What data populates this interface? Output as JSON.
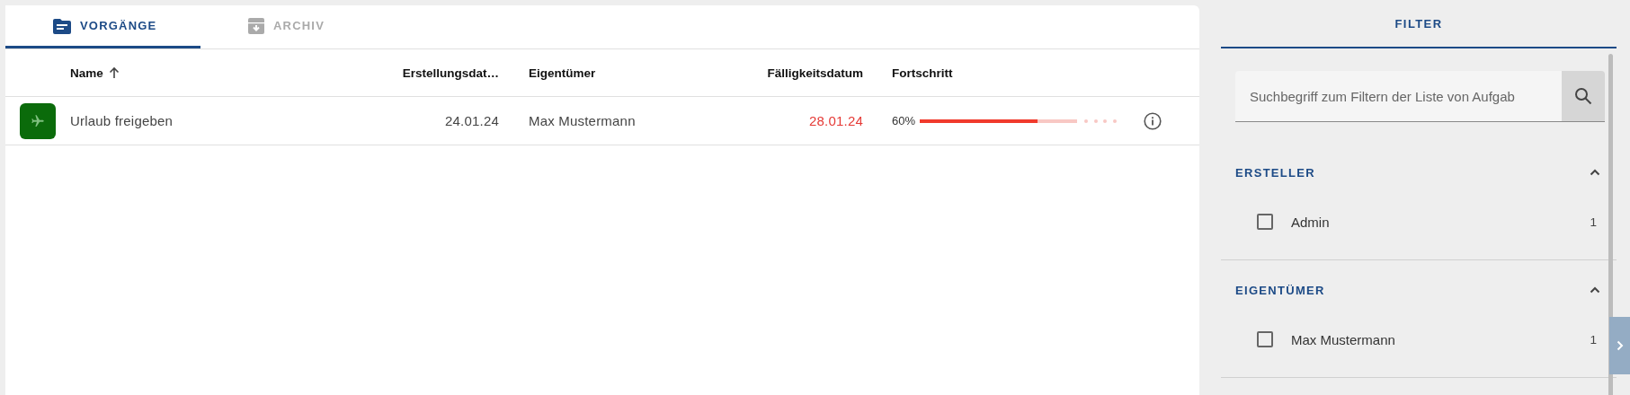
{
  "tabs": [
    {
      "label": "VORGÄNGE",
      "selected": true
    },
    {
      "label": "ARCHIV",
      "selected": false
    }
  ],
  "table": {
    "columns": [
      {
        "label": "Name",
        "sorted": true
      },
      {
        "label": "Erstellungsdat…",
        "sorted": false
      },
      {
        "label": "Eigentümer",
        "sorted": false
      },
      {
        "label": "Fälligkeitsdatum",
        "sorted": false
      },
      {
        "label": "Fortschritt",
        "sorted": false
      }
    ],
    "rows": [
      {
        "name": "Urlaub freigeben",
        "created": "24.01.24",
        "owner": "Max Mustermann",
        "due": "28.01.24",
        "overdue": true,
        "progress": "60%",
        "level": 0.6
      }
    ]
  },
  "filter": {
    "tab": {
      "label": "FILTER",
      "selected": true
    },
    "search": {
      "placeholder": "Suchbegriff zum Filtern der Liste von Aufgab"
    },
    "groups": [
      {
        "title": "ERSTELLER",
        "expanded": true,
        "options": [
          {
            "label": "Admin",
            "count": "1",
            "checked": false
          }
        ]
      },
      {
        "title": "EIGENTÜMER",
        "expanded": true,
        "options": [
          {
            "label": "Max Mustermann",
            "count": "1",
            "checked": false
          }
        ]
      }
    ]
  }
}
